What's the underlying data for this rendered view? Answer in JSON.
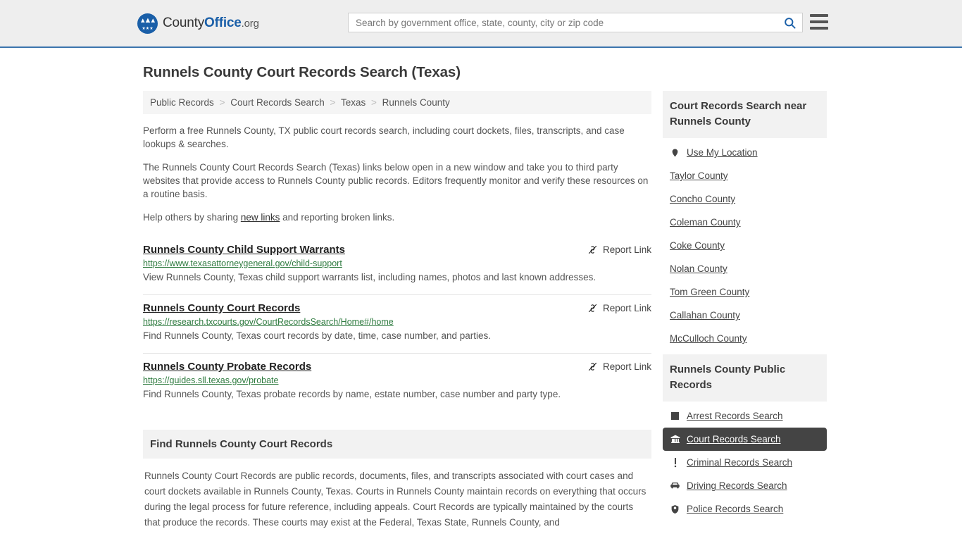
{
  "header": {
    "logo": {
      "text_a": "County",
      "text_b": "Office",
      "text_c": ".org",
      "icon": "eagle-stars-seal"
    },
    "search": {
      "placeholder": "Search by government office, state, county, city or zip code",
      "value": "",
      "icon": "search-icon"
    },
    "menu_icon": "hamburger-menu-icon"
  },
  "page": {
    "title": "Runnels County Court Records Search (Texas)"
  },
  "breadcrumb": {
    "items": [
      "Public Records",
      "Court Records Search",
      "Texas",
      "Runnels County"
    ],
    "separator": ">"
  },
  "intro": {
    "p1": "Perform a free Runnels County, TX public court records search, including court dockets, files, transcripts, and case lookups & searches.",
    "p2": "The Runnels County Court Records Search (Texas) links below open in a new window and take you to third party websites that provide access to Runnels County public records. Editors frequently monitor and verify these resources on a routine basis.",
    "p3_before": "Help others by sharing ",
    "p3_link": "new links",
    "p3_after": " and reporting broken links."
  },
  "results": {
    "report_label": "Report Link",
    "report_icon": "broken-link-icon",
    "items": [
      {
        "title": "Runnels County Child Support Warrants",
        "url": "https://www.texasattorneygeneral.gov/child-support",
        "desc": "View Runnels County, Texas child support warrants list, including names, photos and last known addresses."
      },
      {
        "title": "Runnels County Court Records",
        "url": "https://research.txcourts.gov/CourtRecordsSearch/Home#/home",
        "desc": "Find Runnels County, Texas court records by date, time, case number, and parties."
      },
      {
        "title": "Runnels County Probate Records",
        "url": "https://guides.sll.texas.gov/probate",
        "desc": "Find Runnels County, Texas probate records by name, estate number, case number and party type."
      }
    ]
  },
  "find_section": {
    "heading": "Find Runnels County Court Records",
    "body": "Runnels County Court Records are public records, documents, files, and transcripts associated with court cases and court dockets available in Runnels County, Texas. Courts in Runnels County maintain records on everything that occurs during the legal process for future reference, including appeals. Court Records are typically maintained by the courts that produce the records. These courts may exist at the Federal, Texas State, Runnels County, and"
  },
  "sidebar": {
    "nearby": {
      "heading": "Court Records Search near Runnels County",
      "location_label": "Use My Location",
      "location_icon": "map-pin-icon",
      "counties": [
        "Taylor County",
        "Concho County",
        "Coleman County",
        "Coke County",
        "Nolan County",
        "Tom Green County",
        "Callahan County",
        "McCulloch County"
      ]
    },
    "public_records": {
      "heading": "Runnels County Public Records",
      "items": [
        {
          "label": "Arrest Records Search",
          "icon": "square-icon",
          "active": false
        },
        {
          "label": "Court Records Search",
          "icon": "courthouse-icon",
          "active": true
        },
        {
          "label": "Criminal Records Search",
          "icon": "exclamation-icon",
          "active": false
        },
        {
          "label": "Driving Records Search",
          "icon": "car-icon",
          "active": false
        },
        {
          "label": "Police Records Search",
          "icon": "police-badge-icon",
          "active": false
        }
      ]
    }
  },
  "colors": {
    "header_bg": "#eeeeee",
    "header_border": "#3b74ad",
    "brand_blue": "#1a5fa8",
    "url_green": "#2d7a3e",
    "panel_bg": "#f2f2f2",
    "active_bg": "#444444"
  }
}
